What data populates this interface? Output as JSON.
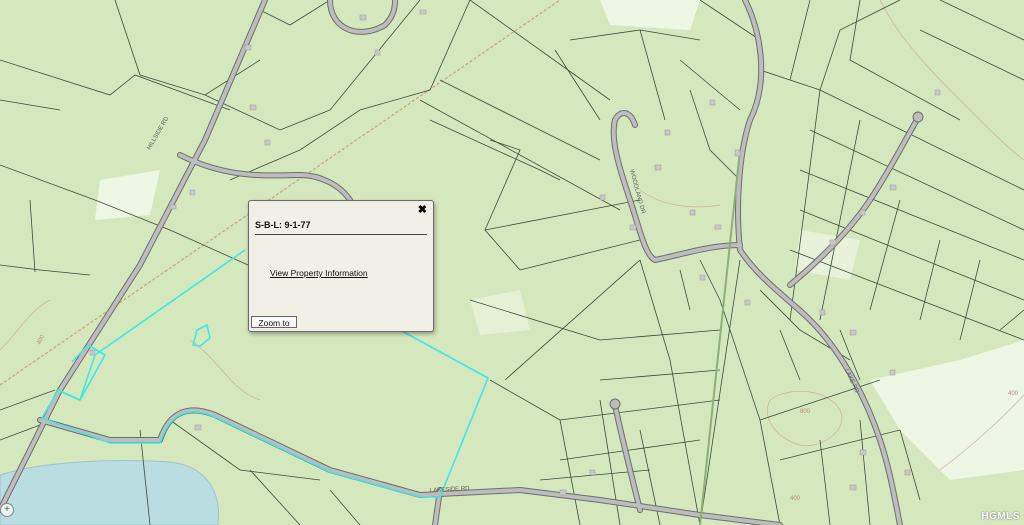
{
  "popup": {
    "title": "S-B-L: 9-1-77",
    "link_label": "View Property Information",
    "zoom_button_label": "Zoom to",
    "close_symbol": "✖"
  },
  "map": {
    "zoom_control_symbol": "+",
    "watermark": "HGMLS",
    "contour_labels": [
      "400",
      "800",
      "400",
      "400"
    ],
    "colors": {
      "background": "#d5e8bd",
      "parcel_lines": "#3c4a3c",
      "roads": "#8b8b8b",
      "highlight": "#3de8e6",
      "water": "#b9dde0",
      "contours": "#c9a394"
    }
  }
}
